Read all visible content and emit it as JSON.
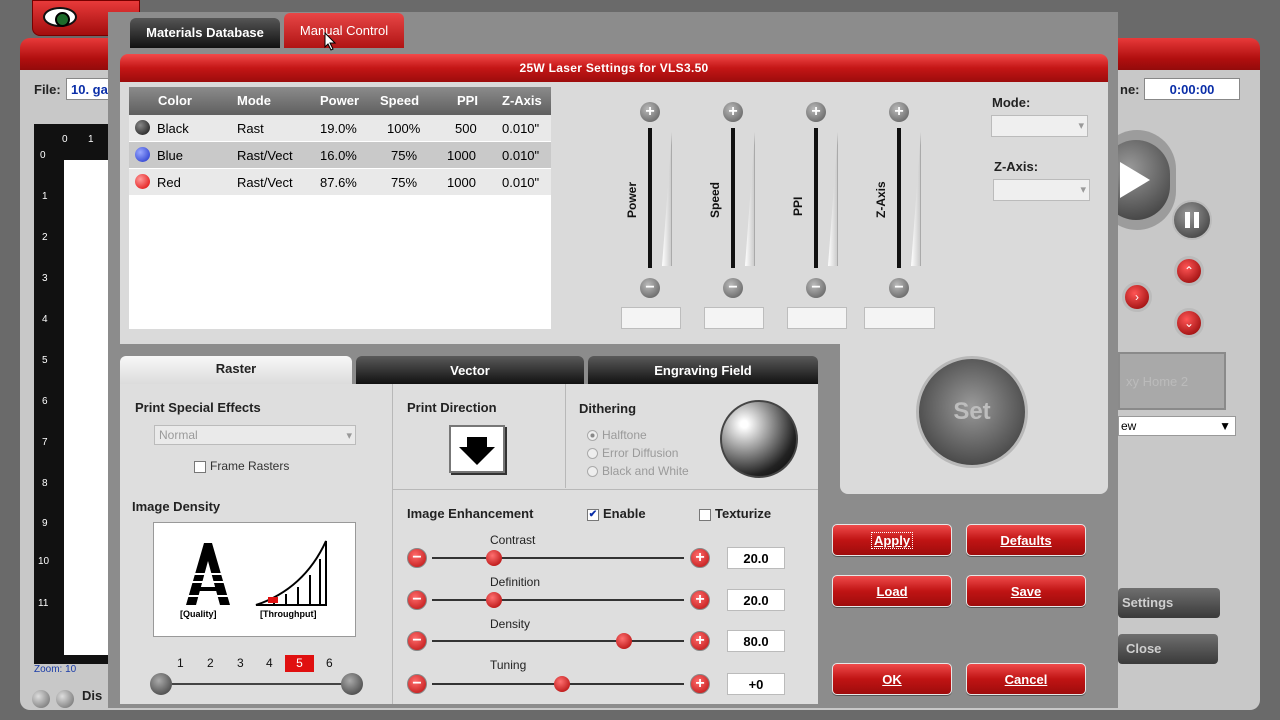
{
  "background": {
    "file_label": "File:",
    "file_value": "10. ga",
    "time_label": "ne:",
    "time_value": "0:00:00",
    "ruler_top": [
      "0",
      "1"
    ],
    "ruler_side": [
      "0",
      "1",
      "2",
      "3",
      "4",
      "5",
      "6",
      "7",
      "8",
      "9",
      "10",
      "11"
    ],
    "zoom_label": "Zoom: 10",
    "display_label": "Dis",
    "gray_boxes": "xy  Home 2",
    "view_select": "ew",
    "settings_button": "Settings",
    "close_button": "Close"
  },
  "tabs": {
    "materials": "Materials Database",
    "manual": "Manual Control"
  },
  "title": "25W Laser Settings for VLS3.50",
  "materials_table": {
    "columns": [
      "Color",
      "Mode",
      "Power",
      "Speed",
      "PPI",
      "Z-Axis"
    ],
    "rows": [
      {
        "color": "Black",
        "mode": "Rast",
        "power": "19.0%",
        "speed": "100%",
        "ppi": "500",
        "zaxis": "0.010\"",
        "dot": "#222222"
      },
      {
        "color": "Blue",
        "mode": "Rast/Vect",
        "power": "16.0%",
        "speed": "75%",
        "ppi": "1000",
        "zaxis": "0.010\"",
        "dot": "#2a3fd8"
      },
      {
        "color": "Red",
        "mode": "Rast/Vect",
        "power": "87.6%",
        "speed": "75%",
        "ppi": "1000",
        "zaxis": "0.010\"",
        "dot": "#e01010"
      }
    ]
  },
  "sliders": {
    "power": "Power",
    "speed": "Speed",
    "ppi": "PPI",
    "zaxis": "Z-Axis"
  },
  "mode_label": "Mode:",
  "zaxis_label": "Z-Axis:",
  "set_button": "Set",
  "bottom_tabs": {
    "raster": "Raster",
    "vector": "Vector",
    "engraving": "Engraving Field"
  },
  "raster": {
    "print_special_effects": "Print Special Effects",
    "effect_value": "Normal",
    "frame_rasters": "Frame Rasters",
    "image_density": "Image Density",
    "quality_label": "[Quality]",
    "throughput_label": "[Throughput]",
    "density_levels": [
      "1",
      "2",
      "3",
      "4",
      "5",
      "6"
    ],
    "density_selected": 5,
    "print_direction": "Print Direction",
    "dithering": "Dithering",
    "dither_options": [
      "Halftone",
      "Error Diffusion",
      "Black and White"
    ],
    "image_enhancement": "Image Enhancement",
    "enable_label": "Enable",
    "enable_checked": true,
    "texturize_label": "Texturize",
    "texturize_checked": false,
    "enhancements": [
      {
        "label": "Contrast",
        "value": "20.0",
        "level": 0.2
      },
      {
        "label": "Definition",
        "value": "20.0",
        "level": 0.2
      },
      {
        "label": "Density",
        "value": "80.0",
        "level": 0.8
      },
      {
        "label": "Tuning",
        "value": "+0",
        "level": 0.5
      }
    ]
  },
  "actions": {
    "apply": "Apply",
    "defaults": "Defaults",
    "load": "Load",
    "save": "Save",
    "ok": "OK",
    "cancel": "Cancel"
  },
  "colors": {
    "accent_red": "#c41616",
    "blue_text": "#0a2ea8"
  }
}
